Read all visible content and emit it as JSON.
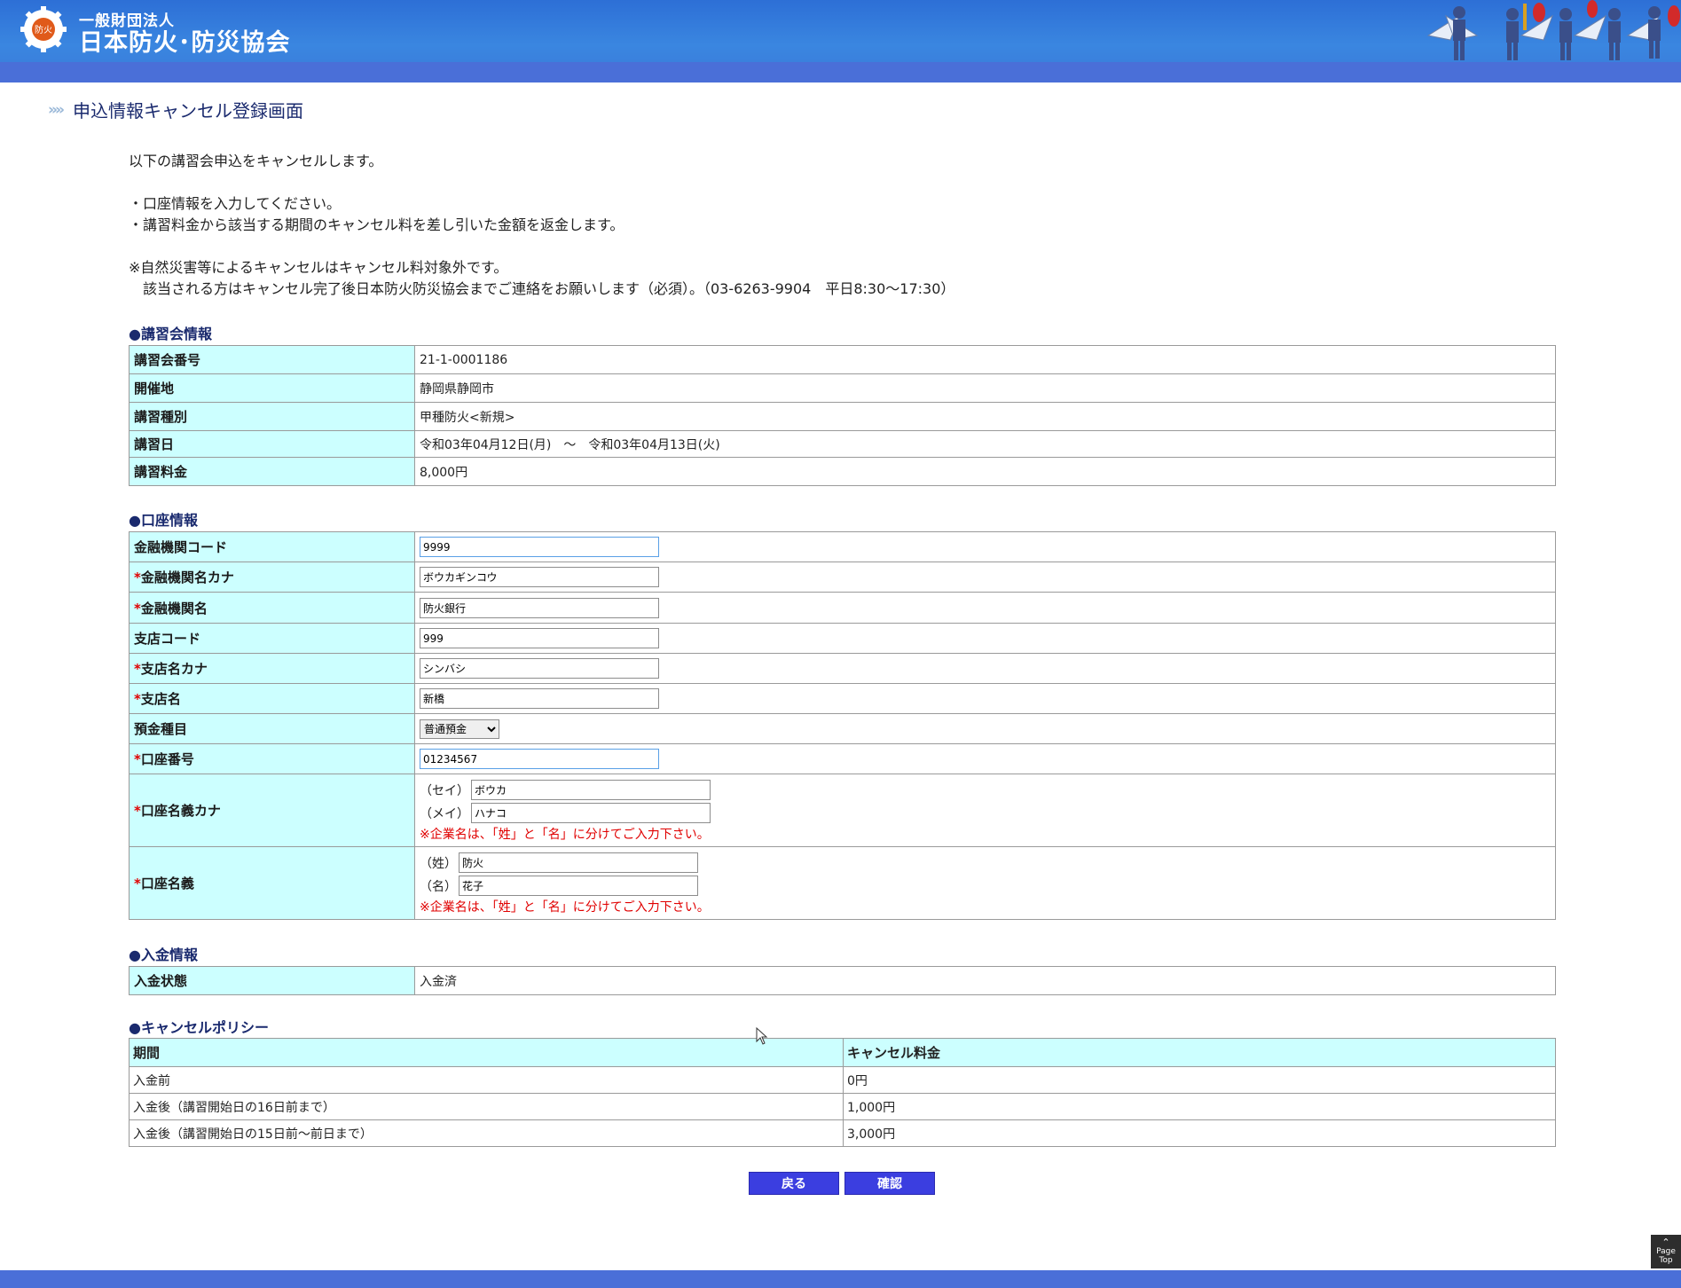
{
  "header": {
    "org_small": "一般財団法人",
    "org_name": "日本防火･防災協会",
    "emblem_text": "防火",
    "colors": {
      "header": "#3a86e0",
      "band": "#4a6fd8"
    }
  },
  "page": {
    "title": "申込情報キャンセル登録画面"
  },
  "intro": {
    "line1": "以下の講習会申込をキャンセルします。",
    "bullet1": "・口座情報を入力してください。",
    "bullet2": "・講習料金から該当する期間のキャンセル料を差し引いた金額を返金します。",
    "note1": "※自然災害等によるキャンセルはキャンセル料対象外です。",
    "note2": "　該当される方はキャンセル完了後日本防火防災協会までご連絡をお願いします（必須）。（03-6263-9904　平日8:30～17:30）"
  },
  "course_section": {
    "title": "●講習会情報",
    "rows": [
      {
        "label": "講習会番号",
        "value": "21-1-0001186"
      },
      {
        "label": "開催地",
        "value": "静岡県静岡市"
      },
      {
        "label": "講習種別",
        "value": "甲種防火<新規>"
      },
      {
        "label": "講習日",
        "value": "令和03年04月12日(月)　～　令和03年04月13日(火)"
      },
      {
        "label": "講習料金",
        "value": "8,000円"
      }
    ]
  },
  "account_section": {
    "title": "●口座情報",
    "required_mark": "*",
    "bank_code": {
      "label": "金融機関コード",
      "value": "9999"
    },
    "bank_kana": {
      "label": "金融機関名カナ",
      "value": "ボウカギンコウ"
    },
    "bank_name": {
      "label": "金融機関名",
      "value": "防火銀行"
    },
    "branch_code": {
      "label": "支店コード",
      "value": "999"
    },
    "branch_kana": {
      "label": "支店名カナ",
      "value": "シンバシ"
    },
    "branch_name": {
      "label": "支店名",
      "value": "新橋"
    },
    "deposit_type": {
      "label": "預金種目",
      "value": "普通預金"
    },
    "account_number": {
      "label": "口座番号",
      "value": "01234567"
    },
    "holder_kana": {
      "label": "口座名義カナ",
      "sei_label": "（セイ）",
      "sei_value": "ボウカ",
      "mei_label": "（メイ）",
      "mei_value": "ハナコ",
      "note": "※企業名は、「姓」と「名」に分けてご入力下さい。"
    },
    "holder": {
      "label": "口座名義",
      "sei_label": "（姓）",
      "sei_value": "防火",
      "mei_label": "（名）",
      "mei_value": "花子",
      "note": "※企業名は、「姓」と「名」に分けてご入力下さい。"
    }
  },
  "payment_section": {
    "title": "●入金情報",
    "label": "入金状態",
    "value": "入金済"
  },
  "policy_section": {
    "title": "●キャンセルポリシー",
    "headers": [
      "期間",
      "キャンセル料金"
    ],
    "rows": [
      [
        "入金前",
        "0円"
      ],
      [
        "入金後（講習開始日の16日前まで）",
        "1,000円"
      ],
      [
        "入金後（講習開始日の15日前～前日まで）",
        "3,000円"
      ]
    ]
  },
  "buttons": {
    "back": "戻る",
    "confirm": "確認"
  },
  "pagetop": {
    "line1": "Page",
    "line2": "Top"
  }
}
